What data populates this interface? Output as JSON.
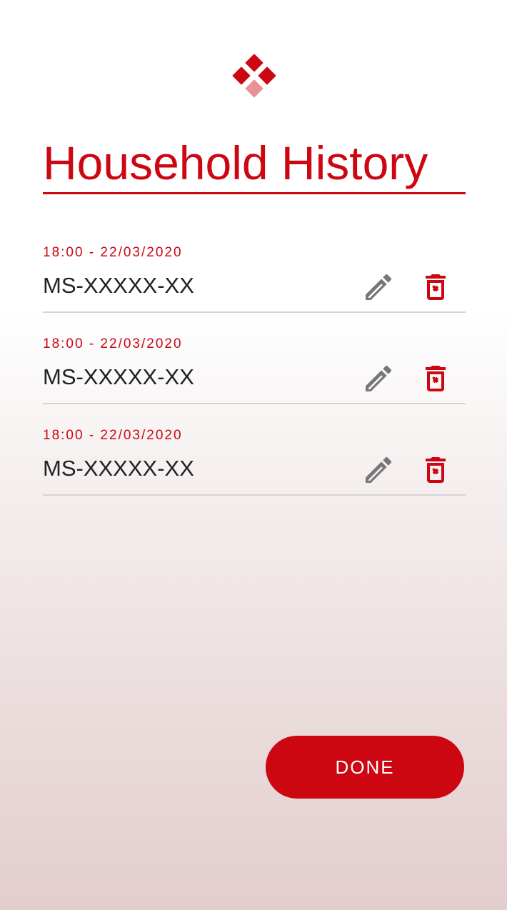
{
  "header": {
    "logo_icon": "diamond-cluster-logo-icon",
    "title": "Household History"
  },
  "entries": [
    {
      "time": "18:00 - 22/03/2020",
      "code": "MS-XXXXX-XX",
      "edit_icon": "pencil-icon",
      "delete_icon": "trash-icon"
    },
    {
      "time": "18:00 - 22/03/2020",
      "code": "MS-XXXXX-XX",
      "edit_icon": "pencil-icon",
      "delete_icon": "trash-icon"
    },
    {
      "time": "18:00 - 22/03/2020",
      "code": "MS-XXXXX-XX",
      "edit_icon": "pencil-icon",
      "delete_icon": "trash-icon"
    }
  ],
  "actions": {
    "done_label": "DONE"
  },
  "colors": {
    "brand": "#cc0712",
    "brand_light": "#e89196",
    "text": "#222222",
    "icon_gray": "#777777",
    "divider": "#d8d4d4"
  }
}
